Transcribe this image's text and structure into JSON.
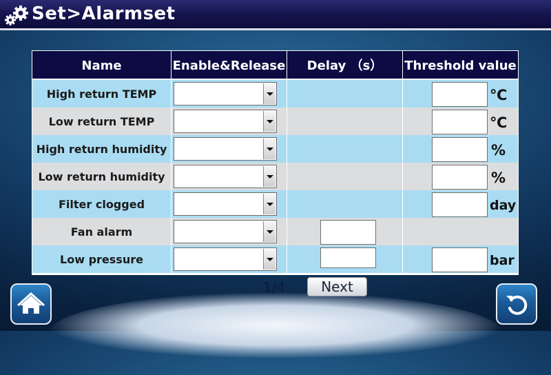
{
  "header": {
    "title": "Set>Alarmset",
    "icon": "gear-icon"
  },
  "table": {
    "columns": [
      "Name",
      "Enable&Release",
      "Delay （s）",
      "Threshold value"
    ],
    "rows": [
      {
        "name": "High return TEMP",
        "unit": "℃"
      },
      {
        "name": "Low return TEMP",
        "unit": "℃"
      },
      {
        "name": "High return humidity",
        "unit": "%"
      },
      {
        "name": "Low return humidity",
        "unit": "%"
      },
      {
        "name": "Filter clogged",
        "unit": "day"
      },
      {
        "name": "Fan alarm",
        "unit": ""
      },
      {
        "name": "Low pressure",
        "unit": "bar"
      }
    ]
  },
  "footer": {
    "page": "1/4",
    "next_label": "Next",
    "home_icon": "home-icon",
    "back_icon": "back-icon"
  },
  "colors": {
    "header_bg": "#16154f",
    "row_blue": "#a9dcf2",
    "row_gray": "#dcdddf",
    "table_header": "#0c0b44"
  }
}
